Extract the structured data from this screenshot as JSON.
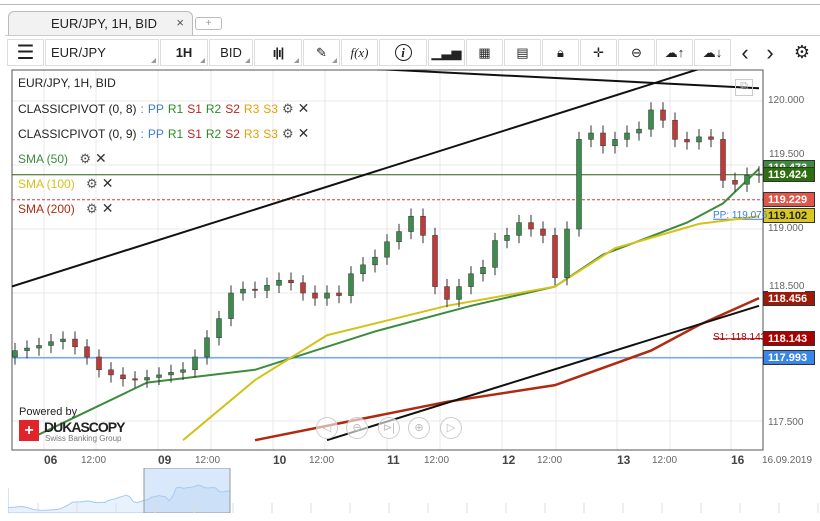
{
  "tab": {
    "title": "EUR/JPY, 1H, BID",
    "close": "×",
    "new": "+"
  },
  "toolbar": {
    "menu": "☰",
    "symbol": "EUR/JPY",
    "period": "1H",
    "side": "BID",
    "fx": "f(x)",
    "info": "i",
    "prev": "‹",
    "next": "›"
  },
  "legend": {
    "title": "EUR/JPY, 1H, BID",
    "pivots": [
      {
        "name": "CLASSICPIVOT (0, 8)"
      },
      {
        "name": "CLASSICPIVOT (0, 9)"
      }
    ],
    "pivot_levels": [
      {
        "t": "PP",
        "c": "#3a7bd5"
      },
      {
        "t": "R1",
        "c": "#2a8a2a"
      },
      {
        "t": "S1",
        "c": "#c02020"
      },
      {
        "t": "R2",
        "c": "#2a8a2a"
      },
      {
        "t": "S2",
        "c": "#c02020"
      },
      {
        "t": "R3",
        "c": "#e8a000"
      },
      {
        "t": "S3",
        "c": "#e8a000"
      }
    ],
    "smas": [
      {
        "name": "SMA (50)",
        "color": "#3d8b3d"
      },
      {
        "name": "SMA (100)",
        "color": "#d4c21a"
      },
      {
        "name": "SMA (200)",
        "color": "#b02a10"
      }
    ]
  },
  "price_axis": {
    "ticks": [
      "120.000",
      "119.500",
      "119.000",
      "118.500",
      "117.500"
    ]
  },
  "time_axis": [
    {
      "t": "06",
      "b": true
    },
    {
      "t": "12:00"
    },
    {
      "t": "09",
      "b": true
    },
    {
      "t": "12:00"
    },
    {
      "t": "10",
      "b": true
    },
    {
      "t": "12:00"
    },
    {
      "t": "11",
      "b": true
    },
    {
      "t": "12:00"
    },
    {
      "t": "12",
      "b": true
    },
    {
      "t": "12:00"
    },
    {
      "t": "13",
      "b": true
    },
    {
      "t": "12:00"
    },
    {
      "t": "16",
      "b": true
    },
    {
      "t": "16.09.2019"
    }
  ],
  "badges": [
    {
      "v": "119.473",
      "c": "#3d8b3d",
      "p": 119.473
    },
    {
      "v": "119.424",
      "c": "#2e6e10",
      "p": 119.424
    },
    {
      "v": "119.229",
      "c": "#e0574a",
      "p": 119.229
    },
    {
      "v": "119.102",
      "c": "#d8c820",
      "p": 119.102,
      "dark": true
    },
    {
      "v": "118.456",
      "c": "#9b1a08",
      "p": 118.456
    },
    {
      "v": "118.143",
      "c": "#a00",
      "p": 118.143
    },
    {
      "v": "117.993",
      "c": "#3a86e8",
      "p": 117.993
    }
  ],
  "level_labels": {
    "pp": "PP: 119.076",
    "s1": "S1: 118.143"
  },
  "branding": {
    "powered": "Powered by",
    "logo": "DUKASCOPY",
    "sub": "Swiss Banking Group"
  },
  "chart_data": {
    "type": "candlestick",
    "symbol": "EUR/JPY",
    "period": "1H",
    "ylim": [
      117.35,
      120.25
    ],
    "closes": [
      118.05,
      118.07,
      118.09,
      118.12,
      118.14,
      118.08,
      118.0,
      117.9,
      117.86,
      117.83,
      117.82,
      117.84,
      117.86,
      117.88,
      117.9,
      118.0,
      118.15,
      118.3,
      118.5,
      118.53,
      118.52,
      118.56,
      118.6,
      118.58,
      118.5,
      118.46,
      118.5,
      118.48,
      118.65,
      118.72,
      118.78,
      118.9,
      118.98,
      119.1,
      118.95,
      118.55,
      118.45,
      118.55,
      118.65,
      118.7,
      118.91,
      118.95,
      119.05,
      119.0,
      118.95,
      118.62,
      119.0,
      119.7,
      119.75,
      119.65,
      119.7,
      119.75,
      119.78,
      119.93,
      119.85,
      119.7,
      119.68,
      119.72,
      119.7,
      119.38,
      119.35,
      119.42,
      119.43
    ],
    "sma50": [
      [
        1,
        117.35
      ],
      [
        11,
        117.8
      ],
      [
        20,
        117.9
      ],
      [
        30,
        118.2
      ],
      [
        38,
        118.4
      ],
      [
        45,
        118.55
      ],
      [
        49,
        118.8
      ],
      [
        56,
        119.05
      ],
      [
        59,
        119.2
      ],
      [
        62,
        119.47
      ]
    ],
    "sma100": [
      [
        14,
        117.35
      ],
      [
        20,
        117.82
      ],
      [
        26,
        118.17
      ],
      [
        36,
        118.4
      ],
      [
        45,
        118.55
      ],
      [
        50,
        118.85
      ],
      [
        57,
        119.04
      ],
      [
        62,
        119.1
      ]
    ],
    "sma200": [
      [
        20,
        117.35
      ],
      [
        28,
        117.5
      ],
      [
        36,
        117.65
      ],
      [
        45,
        117.78
      ],
      [
        53,
        118.05
      ],
      [
        57,
        118.25
      ],
      [
        62,
        118.46
      ]
    ],
    "trendlines": [
      [
        [
          -0.3,
          118.55
        ],
        [
          57,
          120.25
        ]
      ],
      [
        [
          26,
          117.35
        ],
        [
          62,
          118.4
        ]
      ],
      [
        [
          30,
          120.25
        ],
        [
          62,
          120.1
        ]
      ]
    ],
    "hlines": [
      {
        "p": 119.424,
        "c": "#2e5e10"
      },
      {
        "p": 119.229,
        "c": "#c04040",
        "dash": true
      },
      {
        "p": 117.993,
        "c": "#3a86e8"
      }
    ]
  }
}
